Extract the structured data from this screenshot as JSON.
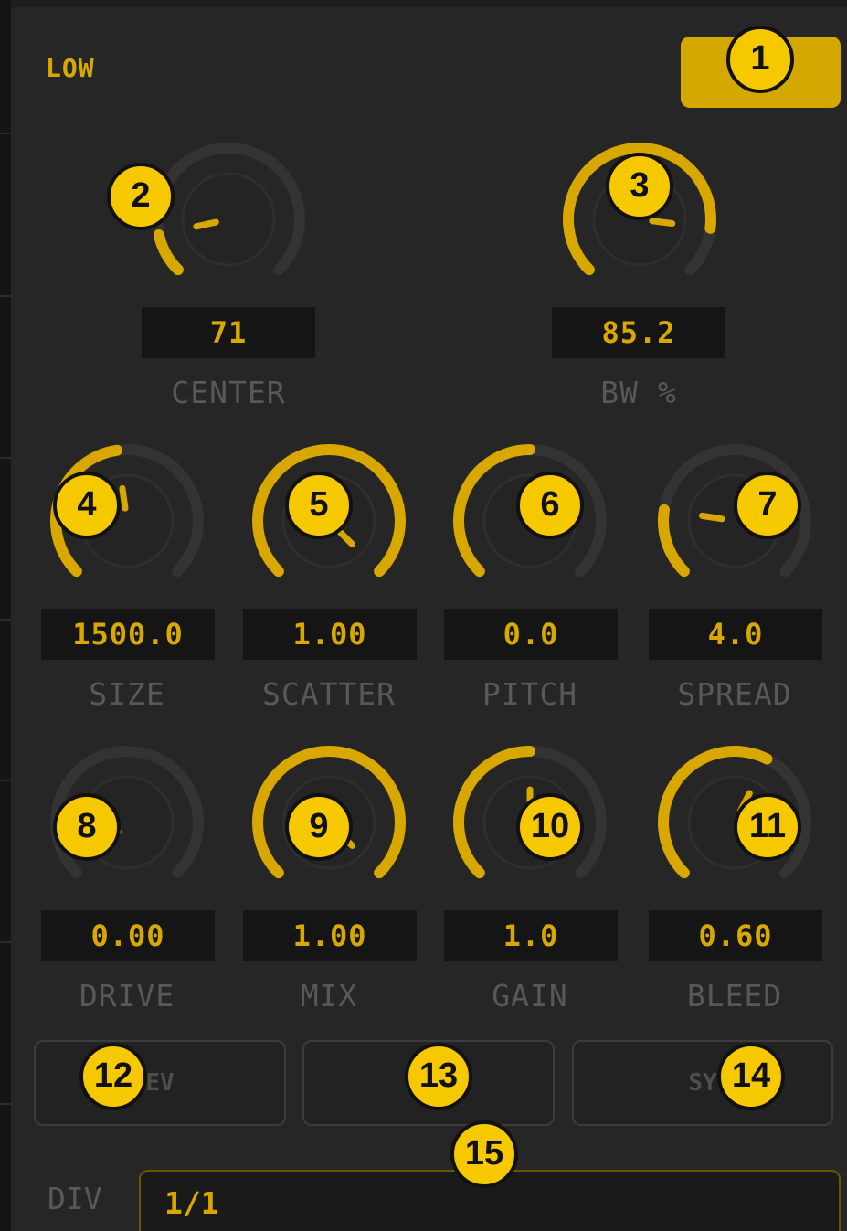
{
  "header": {
    "mode_label": "LOW"
  },
  "colors": {
    "accent": "#d8a800",
    "track": "#333333",
    "panel": "#262626",
    "field": "#151515",
    "label": "#585858"
  },
  "knobs": [
    {
      "id": "center",
      "label": "CENTER",
      "value": "71",
      "fraction": 0.12
    },
    {
      "id": "bw",
      "label": "BW %",
      "value": "85.2",
      "fraction": 0.86
    },
    {
      "id": "size",
      "label": "SIZE",
      "value": "1500.0",
      "fraction": 0.47
    },
    {
      "id": "scatter",
      "label": "SCATTER",
      "value": "1.00",
      "fraction": 1.0
    },
    {
      "id": "pitch",
      "label": "PITCH",
      "value": "0.0",
      "fraction": 0.5
    },
    {
      "id": "spread",
      "label": "SPREAD",
      "value": "4.0",
      "fraction": 0.2
    },
    {
      "id": "drive",
      "label": "DRIVE",
      "value": "0.00",
      "fraction": 0.0
    },
    {
      "id": "mix",
      "label": "MIX",
      "value": "1.00",
      "fraction": 1.0
    },
    {
      "id": "gain",
      "label": "GAIN",
      "value": "1.0",
      "fraction": 0.5
    },
    {
      "id": "bleed",
      "label": "BLEED",
      "value": "0.60",
      "fraction": 0.6
    }
  ],
  "toggles": [
    {
      "id": "rev",
      "label": "EV"
    },
    {
      "id": "mid",
      "label": ""
    },
    {
      "id": "sync",
      "label": "SY"
    }
  ],
  "division": {
    "label": "DIV",
    "value": "1/1"
  },
  "markers": [
    "1",
    "2",
    "3",
    "4",
    "5",
    "6",
    "7",
    "8",
    "9",
    "10",
    "11",
    "12",
    "13",
    "14",
    "15"
  ]
}
